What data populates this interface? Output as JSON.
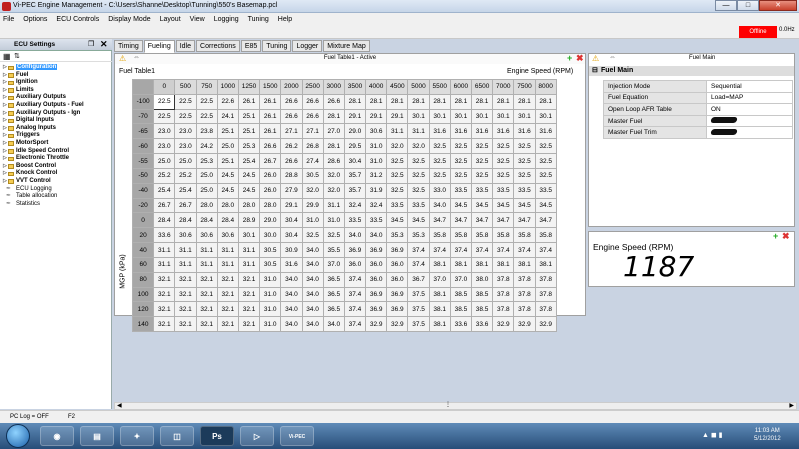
{
  "window": {
    "title": "Vi-PEC Engine Management - C:\\Users\\Shanne\\Desktop\\Tunning\\550's Basemap.pcl",
    "btn_min": "—",
    "btn_max": "□",
    "btn_close": "✕"
  },
  "menu": [
    "File",
    "Options",
    "ECU Controls",
    "Display Mode",
    "Layout",
    "View",
    "Logging",
    "Tuning",
    "Help"
  ],
  "status_indicator": {
    "label": "Offline",
    "freq": "0.0Hz",
    "color": "#ff0000"
  },
  "left_panel": {
    "title": "ECU Settings",
    "pin": "❒",
    "close": "✕",
    "tree": [
      {
        "label": "Configuration",
        "selected": true
      },
      {
        "label": "Fuel"
      },
      {
        "label": "Ignition"
      },
      {
        "label": "Limits"
      },
      {
        "label": "Auxiliary Outputs"
      },
      {
        "label": "Auxiliary Outputs - Fuel"
      },
      {
        "label": "Auxiliary Outputs - Ign"
      },
      {
        "label": "Digital Inputs"
      },
      {
        "label": "Analog Inputs"
      },
      {
        "label": "Triggers"
      },
      {
        "label": "MotorSport"
      },
      {
        "label": "Idle Speed Control"
      },
      {
        "label": "Electronic Throttle"
      },
      {
        "label": "Boost Control"
      },
      {
        "label": "Knock Control"
      },
      {
        "label": "VVT Control"
      },
      {
        "label": "ECU Logging",
        "leaf": true
      },
      {
        "label": "Table allocation",
        "leaf": true
      },
      {
        "label": "Statistics",
        "leaf": true
      }
    ]
  },
  "tabs": [
    "Timing",
    "Fueling",
    "Idle",
    "Corrections",
    "E85",
    "Tuning",
    "Logger",
    "Mixture Map"
  ],
  "active_tab": "Fueling",
  "table": {
    "header_title": "Fuel Table1 - Active",
    "name": "Fuel Table1",
    "x_axis_label": "Engine Speed (RPM)",
    "y_axis_label": "MGP (kPa)",
    "rpm": [
      "0",
      "500",
      "750",
      "1000",
      "1250",
      "1500",
      "2000",
      "2500",
      "3000",
      "3500",
      "4000",
      "4500",
      "5000",
      "5500",
      "6000",
      "6500",
      "7000",
      "7500",
      "8000"
    ],
    "rows": [
      {
        "mgp": "-100",
        "cells": [
          "22.5",
          "22.5",
          "22.5",
          "22.6",
          "26.1",
          "26.1",
          "26.6",
          "26.6",
          "26.6",
          "28.1",
          "28.1",
          "28.1",
          "28.1",
          "28.1",
          "28.1",
          "28.1",
          "28.1",
          "28.1",
          "28.1"
        ]
      },
      {
        "mgp": "-70",
        "cells": [
          "22.5",
          "22.5",
          "22.5",
          "24.1",
          "25.1",
          "26.1",
          "26.6",
          "26.6",
          "28.1",
          "29.1",
          "29.1",
          "29.1",
          "30.1",
          "30.1",
          "30.1",
          "30.1",
          "30.1",
          "30.1",
          "30.1"
        ]
      },
      {
        "mgp": "-65",
        "cells": [
          "23.0",
          "23.0",
          "23.8",
          "25.1",
          "25.1",
          "26.1",
          "27.1",
          "27.1",
          "27.0",
          "29.0",
          "30.6",
          "31.1",
          "31.1",
          "31.6",
          "31.6",
          "31.6",
          "31.6",
          "31.6",
          "31.6"
        ]
      },
      {
        "mgp": "-60",
        "cells": [
          "23.0",
          "23.0",
          "24.2",
          "25.0",
          "25.3",
          "26.6",
          "26.2",
          "26.8",
          "28.1",
          "29.5",
          "31.0",
          "32.0",
          "32.0",
          "32.5",
          "32.5",
          "32.5",
          "32.5",
          "32.5",
          "32.5"
        ]
      },
      {
        "mgp": "-55",
        "cells": [
          "25.0",
          "25.0",
          "25.3",
          "25.1",
          "25.4",
          "26.7",
          "26.6",
          "27.4",
          "28.6",
          "30.4",
          "31.0",
          "32.5",
          "32.5",
          "32.5",
          "32.5",
          "32.5",
          "32.5",
          "32.5",
          "32.5"
        ]
      },
      {
        "mgp": "-50",
        "cells": [
          "25.2",
          "25.2",
          "25.0",
          "24.5",
          "24.5",
          "26.0",
          "28.8",
          "30.5",
          "32.0",
          "35.7",
          "31.2",
          "32.5",
          "32.5",
          "32.5",
          "32.5",
          "32.5",
          "32.5",
          "32.5",
          "32.5"
        ]
      },
      {
        "mgp": "-40",
        "cells": [
          "25.4",
          "25.4",
          "25.0",
          "24.5",
          "24.5",
          "26.0",
          "27.9",
          "32.0",
          "32.0",
          "35.7",
          "31.9",
          "32.5",
          "32.5",
          "33.0",
          "33.5",
          "33.5",
          "33.5",
          "33.5",
          "33.5"
        ]
      },
      {
        "mgp": "-20",
        "cells": [
          "26.7",
          "26.7",
          "28.0",
          "28.0",
          "28.0",
          "28.0",
          "29.1",
          "29.9",
          "31.1",
          "32.4",
          "32.4",
          "33.5",
          "33.5",
          "34.0",
          "34.5",
          "34.5",
          "34.5",
          "34.5",
          "34.5"
        ]
      },
      {
        "mgp": "0",
        "cells": [
          "28.4",
          "28.4",
          "28.4",
          "28.4",
          "28.9",
          "29.0",
          "30.4",
          "31.0",
          "31.0",
          "33.5",
          "33.5",
          "34.5",
          "34.5",
          "34.7",
          "34.7",
          "34.7",
          "34.7",
          "34.7",
          "34.7"
        ]
      },
      {
        "mgp": "20",
        "cells": [
          "33.6",
          "30.6",
          "30.6",
          "30.6",
          "30.1",
          "30.0",
          "30.4",
          "32.5",
          "32.5",
          "34.0",
          "34.0",
          "35.3",
          "35.3",
          "35.8",
          "35.8",
          "35.8",
          "35.8",
          "35.8",
          "35.8"
        ]
      },
      {
        "mgp": "40",
        "cells": [
          "31.1",
          "31.1",
          "31.1",
          "31.1",
          "31.1",
          "30.5",
          "30.9",
          "34.0",
          "35.5",
          "36.9",
          "36.9",
          "36.9",
          "37.4",
          "37.4",
          "37.4",
          "37.4",
          "37.4",
          "37.4",
          "37.4"
        ]
      },
      {
        "mgp": "60",
        "cells": [
          "31.1",
          "31.1",
          "31.1",
          "31.1",
          "31.1",
          "30.5",
          "31.6",
          "34.0",
          "37.0",
          "36.0",
          "36.0",
          "36.0",
          "37.4",
          "38.1",
          "38.1",
          "38.1",
          "38.1",
          "38.1",
          "38.1"
        ]
      },
      {
        "mgp": "80",
        "cells": [
          "32.1",
          "32.1",
          "32.1",
          "32.1",
          "32.1",
          "31.0",
          "34.0",
          "34.0",
          "36.5",
          "37.4",
          "36.0",
          "36.0",
          "36.7",
          "37.0",
          "37.0",
          "38.0",
          "37.8",
          "37.8",
          "37.8"
        ]
      },
      {
        "mgp": "100",
        "cells": [
          "32.1",
          "32.1",
          "32.1",
          "32.1",
          "32.1",
          "31.0",
          "34.0",
          "34.0",
          "36.5",
          "37.4",
          "36.9",
          "36.9",
          "37.5",
          "38.1",
          "38.5",
          "38.5",
          "37.8",
          "37.8",
          "37.8"
        ]
      },
      {
        "mgp": "120",
        "cells": [
          "32.1",
          "32.1",
          "32.1",
          "32.1",
          "32.1",
          "31.0",
          "34.0",
          "34.0",
          "36.5",
          "37.4",
          "36.9",
          "36.9",
          "37.5",
          "38.1",
          "38.5",
          "38.5",
          "37.8",
          "37.8",
          "37.8"
        ]
      },
      {
        "mgp": "140",
        "cells": [
          "32.1",
          "32.1",
          "32.1",
          "32.1",
          "32.1",
          "31.0",
          "34.0",
          "34.0",
          "34.0",
          "37.4",
          "32.9",
          "32.9",
          "37.5",
          "38.1",
          "33.6",
          "33.6",
          "32.9",
          "32.9",
          "32.9"
        ]
      }
    ]
  },
  "properties": {
    "header_title": "Fuel Main",
    "section": "Fuel Main",
    "items": [
      {
        "key": "Injection Mode",
        "value": "Sequential"
      },
      {
        "key": "Fuel Equation",
        "value": "Load=MAP"
      },
      {
        "key": "Open Loop AFR Table",
        "value": "ON"
      },
      {
        "key": "Master Fuel",
        "value": "",
        "redacted": true
      },
      {
        "key": "Master Fuel Trim",
        "value": "",
        "redacted": true
      }
    ]
  },
  "gauge": {
    "label": "Engine Speed (RPM)",
    "value": "1187"
  },
  "statusbar": {
    "pc_log": "PC Log = OFF",
    "key": "F2"
  },
  "taskbar": {
    "time": "11:03 AM",
    "date": "5/12/2012",
    "apps": [
      "firefox-icon",
      "explorer-icon",
      "app-icon",
      "network-icon",
      "photoshop-icon",
      "car-icon",
      "vipec-icon"
    ],
    "ps_label": "Ps",
    "vipec_label": "Vi-PEC"
  }
}
